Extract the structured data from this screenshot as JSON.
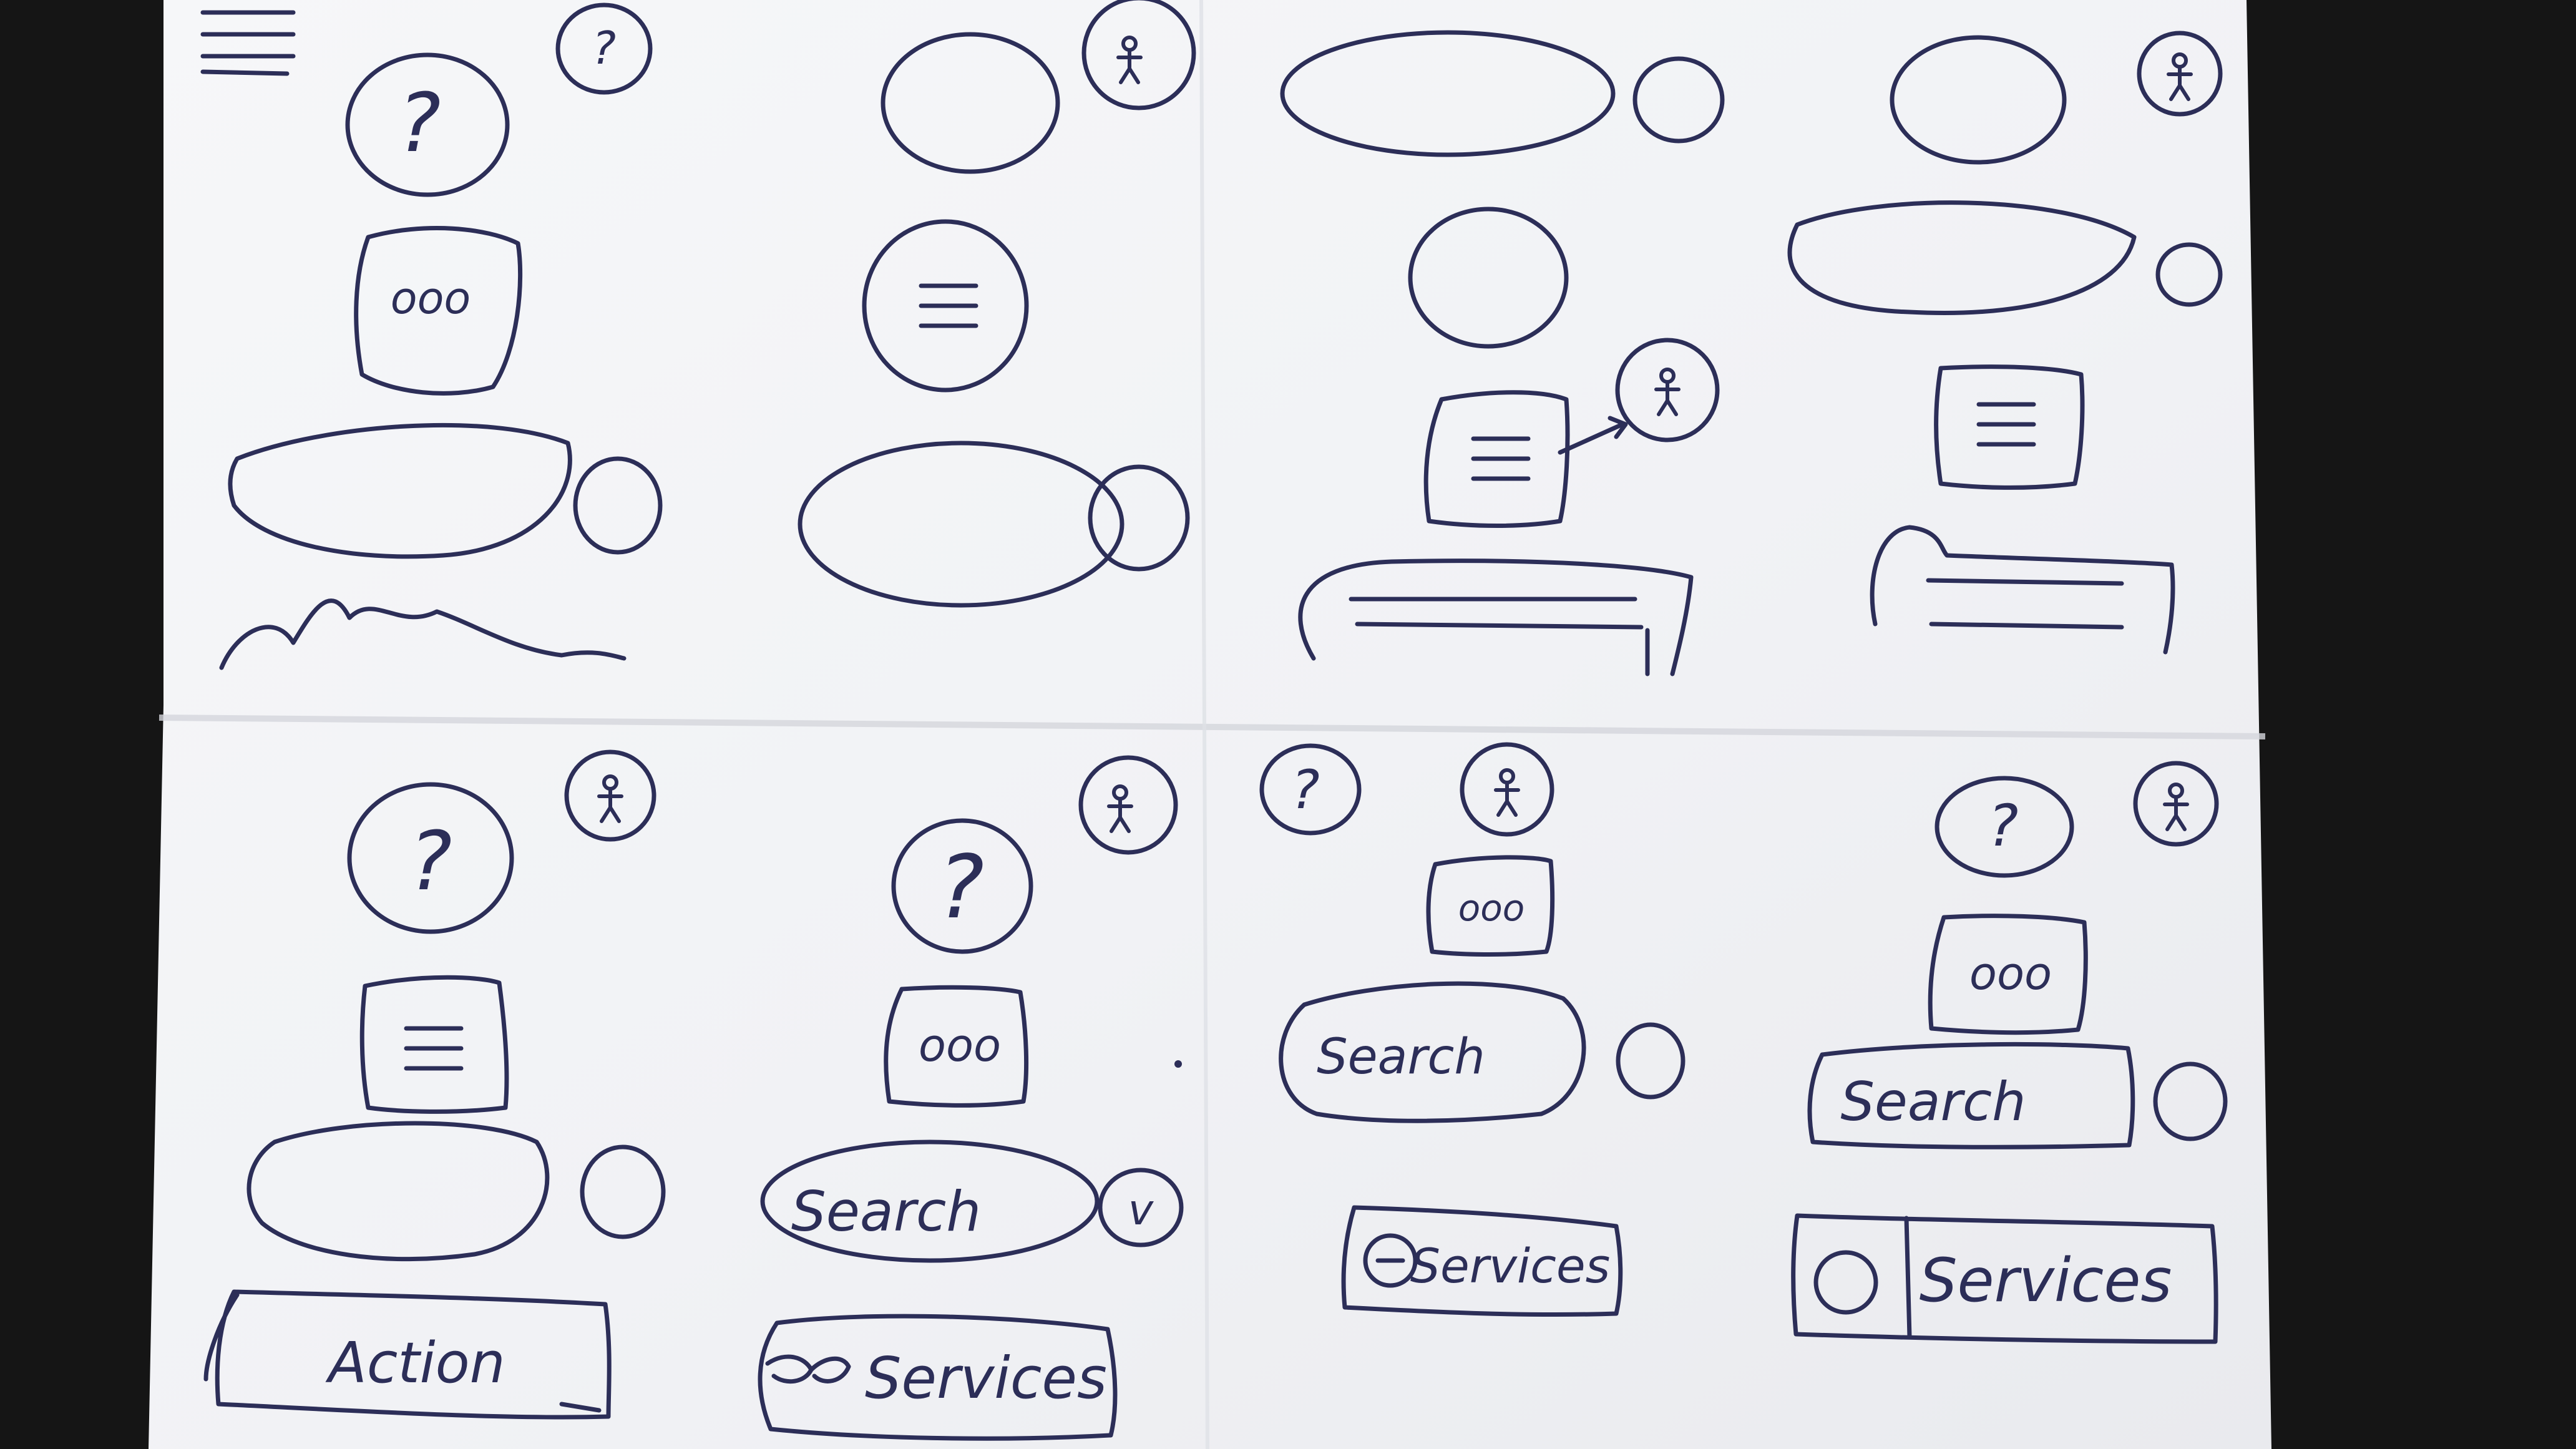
{
  "colors": {
    "background": "#151515",
    "paper": "#f3f4f6",
    "ink": "#2c2e58",
    "fold_shadow": "#d6d8de"
  },
  "labels": {
    "question": "?",
    "dots": "ooo",
    "search": "Search",
    "action": "Action",
    "services": "Services",
    "check": "v"
  },
  "icons": {
    "person": "stick-figure-icon",
    "menu": "hamburger-icon",
    "help": "question-mark-icon",
    "more": "ellipsis-icon"
  }
}
